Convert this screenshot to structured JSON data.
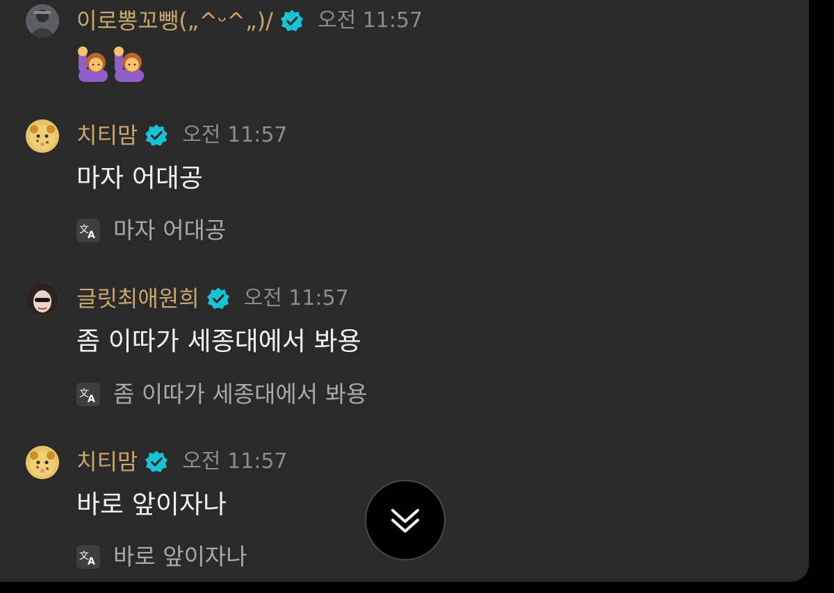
{
  "messages": [
    {
      "username": "이로뽕꼬뺑(„^ᵕ^„)/",
      "time": "오전 11:57",
      "emoji": [
        "raising-hand-emoji",
        "raising-hand-emoji"
      ]
    },
    {
      "username": "치티맘",
      "time": "오전 11:57",
      "text": "마자 어대공",
      "translation": "마자 어대공"
    },
    {
      "username": "글릿최애원희",
      "time": "오전 11:57",
      "text": "좀 이따가 세종대에서 봐용",
      "translation": "좀 이따가 세종대에서 봐용"
    },
    {
      "username": "치티맘",
      "time": "오전 11:57",
      "text": "바로 앞이자나",
      "translation": "바로 앞이자나"
    }
  ],
  "icons": {
    "verified": "verified-badge-icon",
    "translate": "translate-icon",
    "scroll_down": "double-chevron-down-icon"
  },
  "colors": {
    "background": "#2a2a2b",
    "username": "#c9a76e",
    "timestamp": "#8d8d8f",
    "message_text": "#f2f2f2",
    "translation_text": "#a9a9ab",
    "verified_badge": "#19c3d6"
  }
}
